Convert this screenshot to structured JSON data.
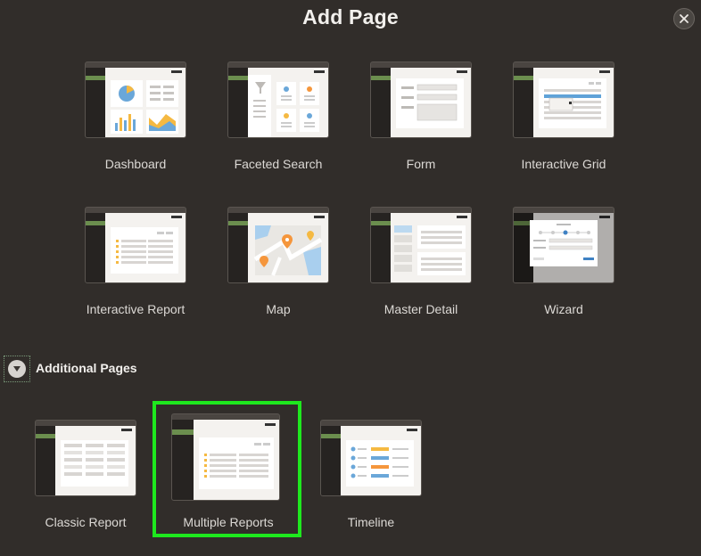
{
  "dialog": {
    "title": "Add Page",
    "close_icon": "close-icon"
  },
  "tiles": [
    {
      "label": "Dashboard",
      "icon": "dashboard-thumbnail"
    },
    {
      "label": "Faceted Search",
      "icon": "faceted-search-thumbnail"
    },
    {
      "label": "Form",
      "icon": "form-thumbnail"
    },
    {
      "label": "Interactive Grid",
      "icon": "interactive-grid-thumbnail"
    },
    {
      "label": "Interactive Report",
      "icon": "interactive-report-thumbnail"
    },
    {
      "label": "Map",
      "icon": "map-thumbnail"
    },
    {
      "label": "Master Detail",
      "icon": "master-detail-thumbnail"
    },
    {
      "label": "Wizard",
      "icon": "wizard-thumbnail"
    }
  ],
  "additional": {
    "label": "Additional Pages",
    "expanded": true,
    "tiles": [
      {
        "label": "Classic Report",
        "icon": "classic-report-thumbnail"
      },
      {
        "label": "Multiple Reports",
        "icon": "multiple-reports-thumbnail",
        "selected": true
      },
      {
        "label": "Timeline",
        "icon": "timeline-thumbnail"
      }
    ]
  },
  "colors": {
    "background": "#312d2a",
    "selection": "#1ee81e",
    "accent_green": "#6b8e4e"
  }
}
